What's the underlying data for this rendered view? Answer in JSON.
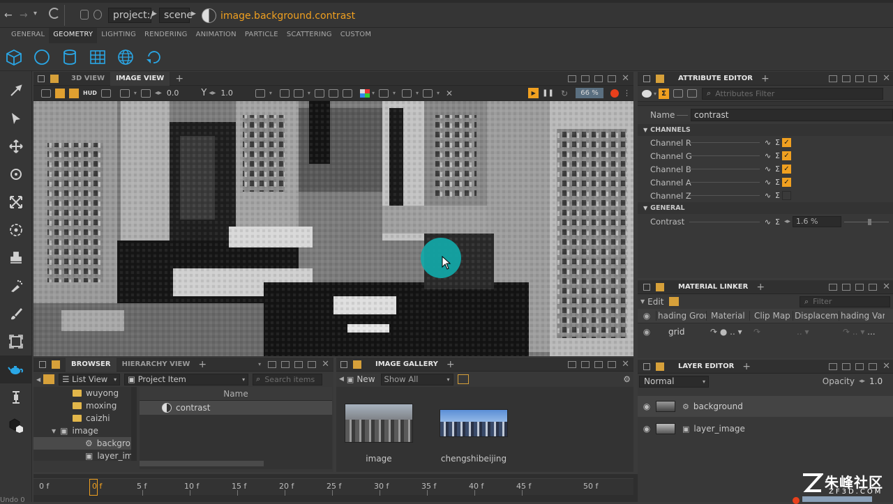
{
  "address": {
    "project": "project:/",
    "scene": "scene",
    "node": "image.background.contrast"
  },
  "shelf": {
    "tabs": [
      "GENERAL",
      "GEOMETRY",
      "LIGHTING",
      "RENDERING",
      "ANIMATION",
      "PARTICLE",
      "SCATTERING",
      "CUSTOM"
    ],
    "active_tab": "GEOMETRY",
    "icons": [
      "cube-icon",
      "sphere-icon",
      "cylinder-icon",
      "grid-icon",
      "globe-icon",
      "import-geometry-icon"
    ]
  },
  "left_tools": [
    "picker-icon",
    "select-arrow-icon",
    "move-icon",
    "rotate-icon",
    "scale-icon",
    "orbit-icon",
    "stamp-icon",
    "spray-icon",
    "brush-icon",
    "frame-icon",
    "teapot-icon",
    "measure-icon",
    "material-icon"
  ],
  "viewport": {
    "tabs": [
      "3D VIEW",
      "IMAGE VIEW"
    ],
    "active_tab": "IMAGE VIEW",
    "hud_label": "HUD",
    "exposure_value": "0.0",
    "gamma_value": "1.0",
    "zoom_value": "66 %"
  },
  "attribute_editor": {
    "title": "ATTRIBUTE EDITOR",
    "filter_placeholder": "Attributes Filter",
    "name_label": "Name",
    "name_value": "contrast",
    "channels_section": "CHANNELS",
    "channels": [
      {
        "label": "Channel R",
        "checked": true
      },
      {
        "label": "Channel G",
        "checked": true
      },
      {
        "label": "Channel B",
        "checked": true
      },
      {
        "label": "Channel A",
        "checked": true
      },
      {
        "label": "Channel Z",
        "checked": false
      }
    ],
    "general_section": "GENERAL",
    "contrast_label": "Contrast",
    "contrast_value": "1.6 %"
  },
  "material_linker": {
    "title": "MATERIAL LINKER",
    "edit_label": "Edit",
    "filter_placeholder": "Filter",
    "columns": [
      "hading Group",
      "Material",
      "Clip Map",
      "Displacement",
      "hading Variable"
    ],
    "row_name": "grid",
    "row_dots": ".. ▾",
    "more": "..."
  },
  "layer_editor": {
    "title": "LAYER EDITOR",
    "blend_mode": "Normal",
    "opacity_label": "Opacity",
    "opacity_value": "1.0",
    "layers": [
      "background",
      "layer_image"
    ]
  },
  "browser": {
    "tabs": [
      "BROWSER",
      "HIERARCHY VIEW"
    ],
    "active_tab": "BROWSER",
    "view_mode": "List View",
    "item_type": "Project Item",
    "search_placeholder": "Search items",
    "column_name": "Name",
    "tree": [
      {
        "label": "wuyong",
        "type": "folder",
        "indent": 1
      },
      {
        "label": "moxing",
        "type": "folder",
        "indent": 1
      },
      {
        "label": "caizhi",
        "type": "folder",
        "indent": 1
      },
      {
        "label": "image",
        "type": "image",
        "indent": 0
      },
      {
        "label": "backgro",
        "type": "node",
        "indent": 2
      },
      {
        "label": "layer_im",
        "type": "image",
        "indent": 2
      }
    ],
    "list_items": [
      "contrast"
    ]
  },
  "image_gallery": {
    "title": "IMAGE GALLERY",
    "new_label": "New",
    "filter_value": "Show All",
    "items": [
      "image",
      "chengshibeijing"
    ]
  },
  "timeline": {
    "start_label": "0 f",
    "current_label": "0 f",
    "end_label": "50 f",
    "ticks": [
      "5 f",
      "10 f",
      "15 f",
      "20 f",
      "25 f",
      "30 f",
      "35 f",
      "40 f",
      "45 f",
      "50 f"
    ]
  },
  "status": {
    "left_text": "Undo 0",
    "watermark_text": "朱峰社区",
    "watermark_url": "ZF3D.COM"
  },
  "colors": {
    "accent": "#f0a020",
    "icon_blue": "#2aa7e6",
    "record_red": "#e8401c",
    "cursor_highlight": "#12a8a8"
  }
}
